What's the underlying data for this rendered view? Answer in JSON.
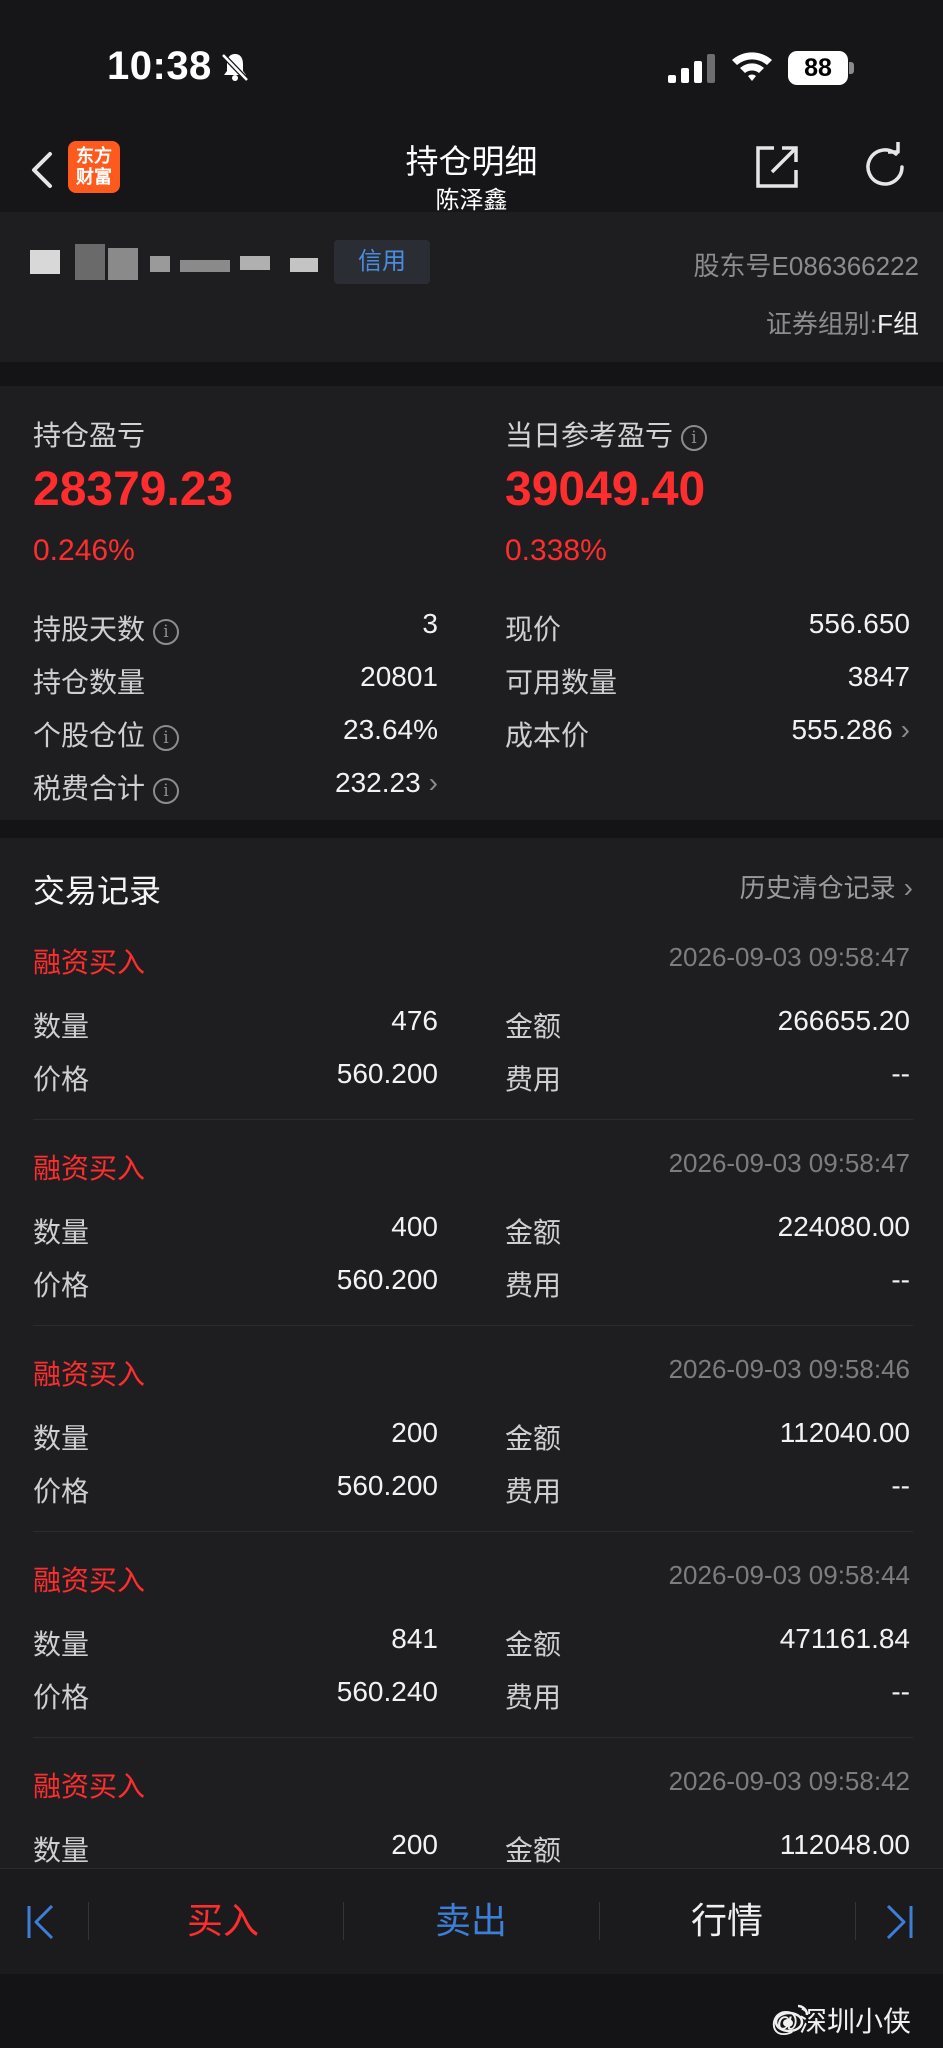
{
  "status_bar": {
    "time": "10:38",
    "battery": "88"
  },
  "nav": {
    "title": "持仓明细",
    "subtitle": "陈泽鑫",
    "logo_line1": "东方",
    "logo_line2": "财富"
  },
  "account": {
    "badge": "信用",
    "shareholder": "股东号E086366222",
    "group_label": "证券组别:",
    "group_value": "F组"
  },
  "summary": {
    "position_pl_label": "持仓盈亏",
    "position_pl_value": "28379.23",
    "position_pl_pct": "0.246%",
    "daily_pl_label": "当日参考盈亏",
    "daily_pl_value": "39049.40",
    "daily_pl_pct": "0.338%",
    "left_rows": [
      {
        "label": "持股天数",
        "value": "3"
      },
      {
        "label": "持仓数量",
        "value": "20801"
      },
      {
        "label": "个股仓位",
        "value": "23.64%"
      },
      {
        "label": "税费合计",
        "value": "232.23"
      }
    ],
    "right_rows": [
      {
        "label": "现价",
        "value": "556.650"
      },
      {
        "label": "可用数量",
        "value": "3847"
      },
      {
        "label": "成本价",
        "value": "555.286"
      }
    ]
  },
  "trades_section": {
    "title": "交易记录",
    "history_link": "历史清仓记录"
  },
  "trades": [
    {
      "type": "融资买入",
      "time": "2026-09-03 09:58:47",
      "qty_label": "数量",
      "qty": "476",
      "amount_label": "金额",
      "amount": "266655.20",
      "price_label": "价格",
      "price": "560.200",
      "fee_label": "费用",
      "fee": "--"
    },
    {
      "type": "融资买入",
      "time": "2026-09-03 09:58:47",
      "qty_label": "数量",
      "qty": "400",
      "amount_label": "金额",
      "amount": "224080.00",
      "price_label": "价格",
      "price": "560.200",
      "fee_label": "费用",
      "fee": "--"
    },
    {
      "type": "融资买入",
      "time": "2026-09-03 09:58:46",
      "qty_label": "数量",
      "qty": "200",
      "amount_label": "金额",
      "amount": "112040.00",
      "price_label": "价格",
      "price": "560.200",
      "fee_label": "费用",
      "fee": "--"
    },
    {
      "type": "融资买入",
      "time": "2026-09-03 09:58:44",
      "qty_label": "数量",
      "qty": "841",
      "amount_label": "金额",
      "amount": "471161.84",
      "price_label": "价格",
      "price": "560.240",
      "fee_label": "费用",
      "fee": "--"
    },
    {
      "type": "融资买入",
      "time": "2026-09-03 09:58:42",
      "qty_label": "数量",
      "qty": "200",
      "amount_label": "金额",
      "amount": "112048.00"
    }
  ],
  "bottom_bar": {
    "buy": "买入",
    "sell": "卖出",
    "market": "行情"
  },
  "watermark": "@深圳小侠",
  "colors": {
    "up_red": "#ff2d2d",
    "accent_blue": "#4a8de0",
    "brand_orange": "#ff5a1e",
    "background": "#141416",
    "card": "#1e1e21"
  }
}
